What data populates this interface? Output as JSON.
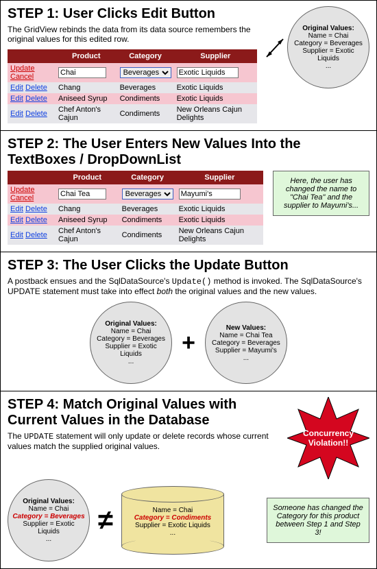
{
  "steps": {
    "s1": {
      "title": "STEP 1: User Clicks Edit Button",
      "desc": "The GridView rebinds the data from its data source remembers the original values for this edited row."
    },
    "s2": {
      "title": "STEP 2: The User Enters New Values Into the TextBoxes / DropDownList",
      "note": "Here, the user has changed the name to \"Chai Tea\" and the supplier to Mayumi's..."
    },
    "s3": {
      "title": "STEP 3: The User Clicks the Update Button",
      "desc_a": "A postback ensues and the SqlDataSource's ",
      "desc_code": "Update()",
      "desc_b": " method is invoked. The SqlDataSource's UPDATE statement must take into effect ",
      "desc_i": "both",
      "desc_c": " the original values and the new values.",
      "plus": "+"
    },
    "s4": {
      "title": "STEP 4: Match Original Values with Current Values in the Database",
      "desc_a": "The ",
      "desc_code": "UPDATE",
      "desc_b": " statement will only update or delete records whose current values match the supplied original values.",
      "neq": "≠",
      "starline1": "Concurrency",
      "starline2": "Violation!!",
      "note": "Someone has changed the Category for this product between Step 1 and Step 3!"
    }
  },
  "headers": {
    "product": "Product",
    "category": "Category",
    "supplier": "Supplier"
  },
  "links": {
    "update": "Update",
    "cancel": "Cancel",
    "edit": "Edit",
    "delete": "Delete"
  },
  "bubbles": {
    "orig": {
      "title": "Original Values:",
      "l1": "Name = Chai",
      "l2": "Category = Beverages",
      "l3": "Supplier = Exotic Liquids",
      "dots": "..."
    },
    "newv": {
      "title": "New Values:",
      "l1": "Name = Chai Tea",
      "l2": "Category = Beverages",
      "l3": "Supplier = Mayumi's",
      "dots": "..."
    },
    "orig_red": {
      "title": "Original Values:",
      "l1": "Name = Chai",
      "l2": "Category = Beverages",
      "l3": "Supplier = Exotic Liquids",
      "dots": "..."
    }
  },
  "cylinder": {
    "l1": "Name = Chai",
    "l2": "Category = Condiments",
    "l3": "Supplier = Exotic Liquids",
    "dots": "..."
  },
  "grid1": {
    "editrow": {
      "product": "Chai",
      "category": "Beverages",
      "supplier": "Exotic Liquids"
    },
    "rows": [
      {
        "product": "Chang",
        "category": "Beverages",
        "supplier": "Exotic Liquids"
      },
      {
        "product": "Aniseed Syrup",
        "category": "Condiments",
        "supplier": "Exotic Liquids"
      },
      {
        "product": "Chef Anton's Cajun",
        "category": "Condiments",
        "supplier": "New Orleans Cajun Delights"
      }
    ]
  },
  "grid2": {
    "editrow": {
      "product": "Chai Tea",
      "category": "Beverages",
      "supplier": "Mayumi's"
    },
    "rows": [
      {
        "product": "Chang",
        "category": "Beverages",
        "supplier": "Exotic Liquids"
      },
      {
        "product": "Aniseed Syrup",
        "category": "Condiments",
        "supplier": "Exotic Liquids"
      },
      {
        "product": "Chef Anton's Cajun",
        "category": "Condiments",
        "supplier": "New Orleans Cajun Delights"
      }
    ]
  }
}
